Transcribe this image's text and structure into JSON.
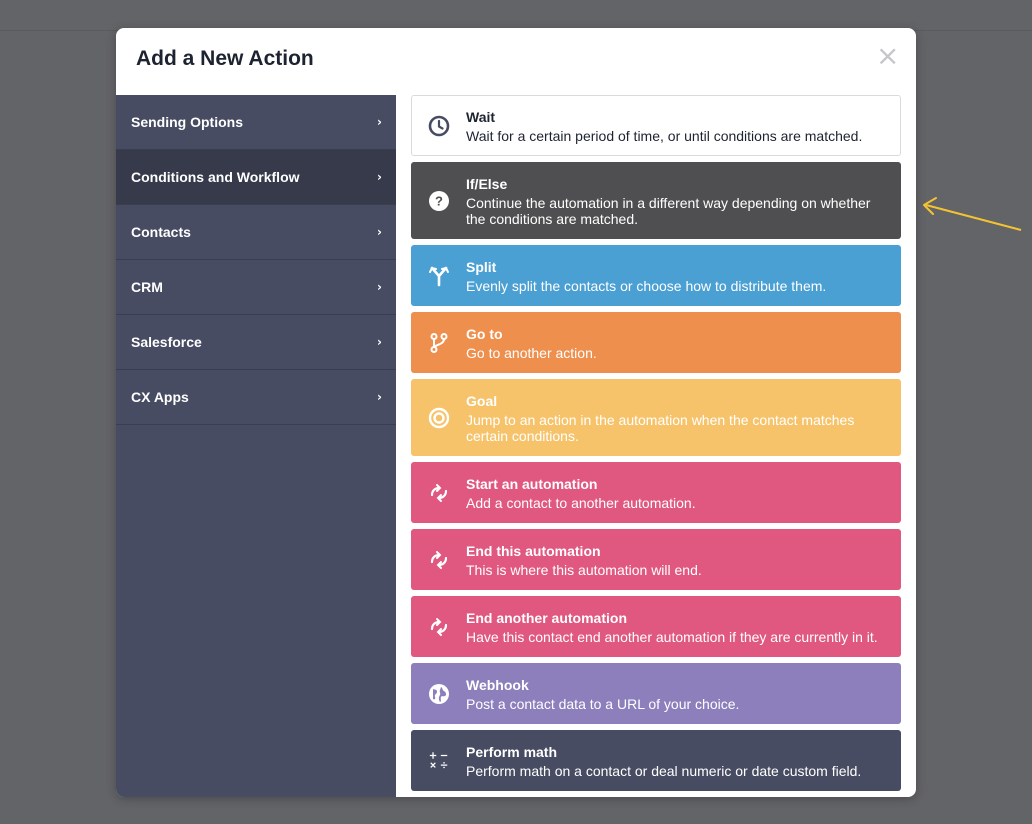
{
  "modal": {
    "title": "Add a New Action",
    "close_icon": "close-icon"
  },
  "sidebar": {
    "items": [
      {
        "label": "Sending Options",
        "active": false
      },
      {
        "label": "Conditions and Workflow",
        "active": true
      },
      {
        "label": "Contacts",
        "active": false
      },
      {
        "label": "CRM",
        "active": false
      },
      {
        "label": "Salesforce",
        "active": false
      },
      {
        "label": "CX Apps",
        "active": false
      }
    ]
  },
  "actions": [
    {
      "title": "Wait",
      "desc": "Wait for a certain period of time, or until conditions are matched.",
      "icon": "clock-icon",
      "color": "#ffffff",
      "text_color": "#1d2330"
    },
    {
      "title": "If/Else",
      "desc": "Continue the automation in a different way depending on whether the conditions are matched.",
      "icon": "question-icon",
      "color": "#4f4f51"
    },
    {
      "title": "Split",
      "desc": "Evenly split the contacts or choose how to distribute them.",
      "icon": "split-icon",
      "color": "#4a9fd3"
    },
    {
      "title": "Go to",
      "desc": "Go to another action.",
      "icon": "goto-icon",
      "color": "#ee8f4e"
    },
    {
      "title": "Goal",
      "desc": "Jump to an action in the automation when the contact matches certain conditions.",
      "icon": "target-icon",
      "color": "#f6c36a"
    },
    {
      "title": "Start an automation",
      "desc": "Add a contact to another automation.",
      "icon": "refresh-icon",
      "color": "#e05780"
    },
    {
      "title": "End this automation",
      "desc": "This is where this automation will end.",
      "icon": "refresh-icon",
      "color": "#e05780"
    },
    {
      "title": "End another automation",
      "desc": "Have this contact end another automation if they are currently in it.",
      "icon": "refresh-icon",
      "color": "#e05780"
    },
    {
      "title": "Webhook",
      "desc": "Post a contact data to a URL of your choice.",
      "icon": "globe-icon",
      "color": "#8c7fbc"
    },
    {
      "title": "Perform math",
      "desc": "Perform math on a contact or deal numeric or date custom field.",
      "icon": "math-icon",
      "color": "#474c62"
    }
  ],
  "colors": {
    "overlay": "#636468",
    "sidebar": "#474c62",
    "sidebar_active": "#363a4b",
    "annotation_arrow": "#f3c431"
  }
}
